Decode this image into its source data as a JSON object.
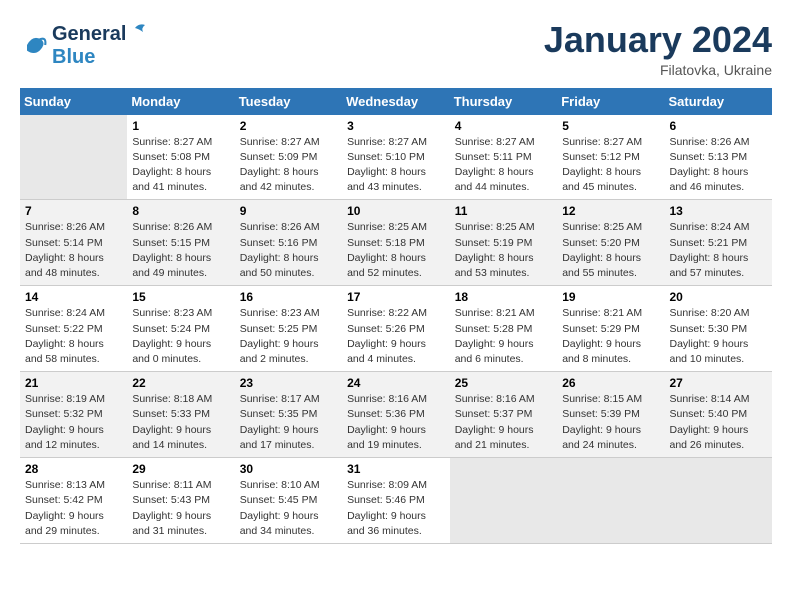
{
  "header": {
    "logo_line1": "General",
    "logo_line2": "Blue",
    "month_year": "January 2024",
    "location": "Filatovka, Ukraine"
  },
  "weekdays": [
    "Sunday",
    "Monday",
    "Tuesday",
    "Wednesday",
    "Thursday",
    "Friday",
    "Saturday"
  ],
  "weeks": [
    [
      {
        "day": "",
        "info": ""
      },
      {
        "day": "1",
        "info": "Sunrise: 8:27 AM\nSunset: 5:08 PM\nDaylight: 8 hours\nand 41 minutes."
      },
      {
        "day": "2",
        "info": "Sunrise: 8:27 AM\nSunset: 5:09 PM\nDaylight: 8 hours\nand 42 minutes."
      },
      {
        "day": "3",
        "info": "Sunrise: 8:27 AM\nSunset: 5:10 PM\nDaylight: 8 hours\nand 43 minutes."
      },
      {
        "day": "4",
        "info": "Sunrise: 8:27 AM\nSunset: 5:11 PM\nDaylight: 8 hours\nand 44 minutes."
      },
      {
        "day": "5",
        "info": "Sunrise: 8:27 AM\nSunset: 5:12 PM\nDaylight: 8 hours\nand 45 minutes."
      },
      {
        "day": "6",
        "info": "Sunrise: 8:26 AM\nSunset: 5:13 PM\nDaylight: 8 hours\nand 46 minutes."
      }
    ],
    [
      {
        "day": "7",
        "info": "Sunrise: 8:26 AM\nSunset: 5:14 PM\nDaylight: 8 hours\nand 48 minutes."
      },
      {
        "day": "8",
        "info": "Sunrise: 8:26 AM\nSunset: 5:15 PM\nDaylight: 8 hours\nand 49 minutes."
      },
      {
        "day": "9",
        "info": "Sunrise: 8:26 AM\nSunset: 5:16 PM\nDaylight: 8 hours\nand 50 minutes."
      },
      {
        "day": "10",
        "info": "Sunrise: 8:25 AM\nSunset: 5:18 PM\nDaylight: 8 hours\nand 52 minutes."
      },
      {
        "day": "11",
        "info": "Sunrise: 8:25 AM\nSunset: 5:19 PM\nDaylight: 8 hours\nand 53 minutes."
      },
      {
        "day": "12",
        "info": "Sunrise: 8:25 AM\nSunset: 5:20 PM\nDaylight: 8 hours\nand 55 minutes."
      },
      {
        "day": "13",
        "info": "Sunrise: 8:24 AM\nSunset: 5:21 PM\nDaylight: 8 hours\nand 57 minutes."
      }
    ],
    [
      {
        "day": "14",
        "info": "Sunrise: 8:24 AM\nSunset: 5:22 PM\nDaylight: 8 hours\nand 58 minutes."
      },
      {
        "day": "15",
        "info": "Sunrise: 8:23 AM\nSunset: 5:24 PM\nDaylight: 9 hours\nand 0 minutes."
      },
      {
        "day": "16",
        "info": "Sunrise: 8:23 AM\nSunset: 5:25 PM\nDaylight: 9 hours\nand 2 minutes."
      },
      {
        "day": "17",
        "info": "Sunrise: 8:22 AM\nSunset: 5:26 PM\nDaylight: 9 hours\nand 4 minutes."
      },
      {
        "day": "18",
        "info": "Sunrise: 8:21 AM\nSunset: 5:28 PM\nDaylight: 9 hours\nand 6 minutes."
      },
      {
        "day": "19",
        "info": "Sunrise: 8:21 AM\nSunset: 5:29 PM\nDaylight: 9 hours\nand 8 minutes."
      },
      {
        "day": "20",
        "info": "Sunrise: 8:20 AM\nSunset: 5:30 PM\nDaylight: 9 hours\nand 10 minutes."
      }
    ],
    [
      {
        "day": "21",
        "info": "Sunrise: 8:19 AM\nSunset: 5:32 PM\nDaylight: 9 hours\nand 12 minutes."
      },
      {
        "day": "22",
        "info": "Sunrise: 8:18 AM\nSunset: 5:33 PM\nDaylight: 9 hours\nand 14 minutes."
      },
      {
        "day": "23",
        "info": "Sunrise: 8:17 AM\nSunset: 5:35 PM\nDaylight: 9 hours\nand 17 minutes."
      },
      {
        "day": "24",
        "info": "Sunrise: 8:16 AM\nSunset: 5:36 PM\nDaylight: 9 hours\nand 19 minutes."
      },
      {
        "day": "25",
        "info": "Sunrise: 8:16 AM\nSunset: 5:37 PM\nDaylight: 9 hours\nand 21 minutes."
      },
      {
        "day": "26",
        "info": "Sunrise: 8:15 AM\nSunset: 5:39 PM\nDaylight: 9 hours\nand 24 minutes."
      },
      {
        "day": "27",
        "info": "Sunrise: 8:14 AM\nSunset: 5:40 PM\nDaylight: 9 hours\nand 26 minutes."
      }
    ],
    [
      {
        "day": "28",
        "info": "Sunrise: 8:13 AM\nSunset: 5:42 PM\nDaylight: 9 hours\nand 29 minutes."
      },
      {
        "day": "29",
        "info": "Sunrise: 8:11 AM\nSunset: 5:43 PM\nDaylight: 9 hours\nand 31 minutes."
      },
      {
        "day": "30",
        "info": "Sunrise: 8:10 AM\nSunset: 5:45 PM\nDaylight: 9 hours\nand 34 minutes."
      },
      {
        "day": "31",
        "info": "Sunrise: 8:09 AM\nSunset: 5:46 PM\nDaylight: 9 hours\nand 36 minutes."
      },
      {
        "day": "",
        "info": ""
      },
      {
        "day": "",
        "info": ""
      },
      {
        "day": "",
        "info": ""
      }
    ]
  ]
}
